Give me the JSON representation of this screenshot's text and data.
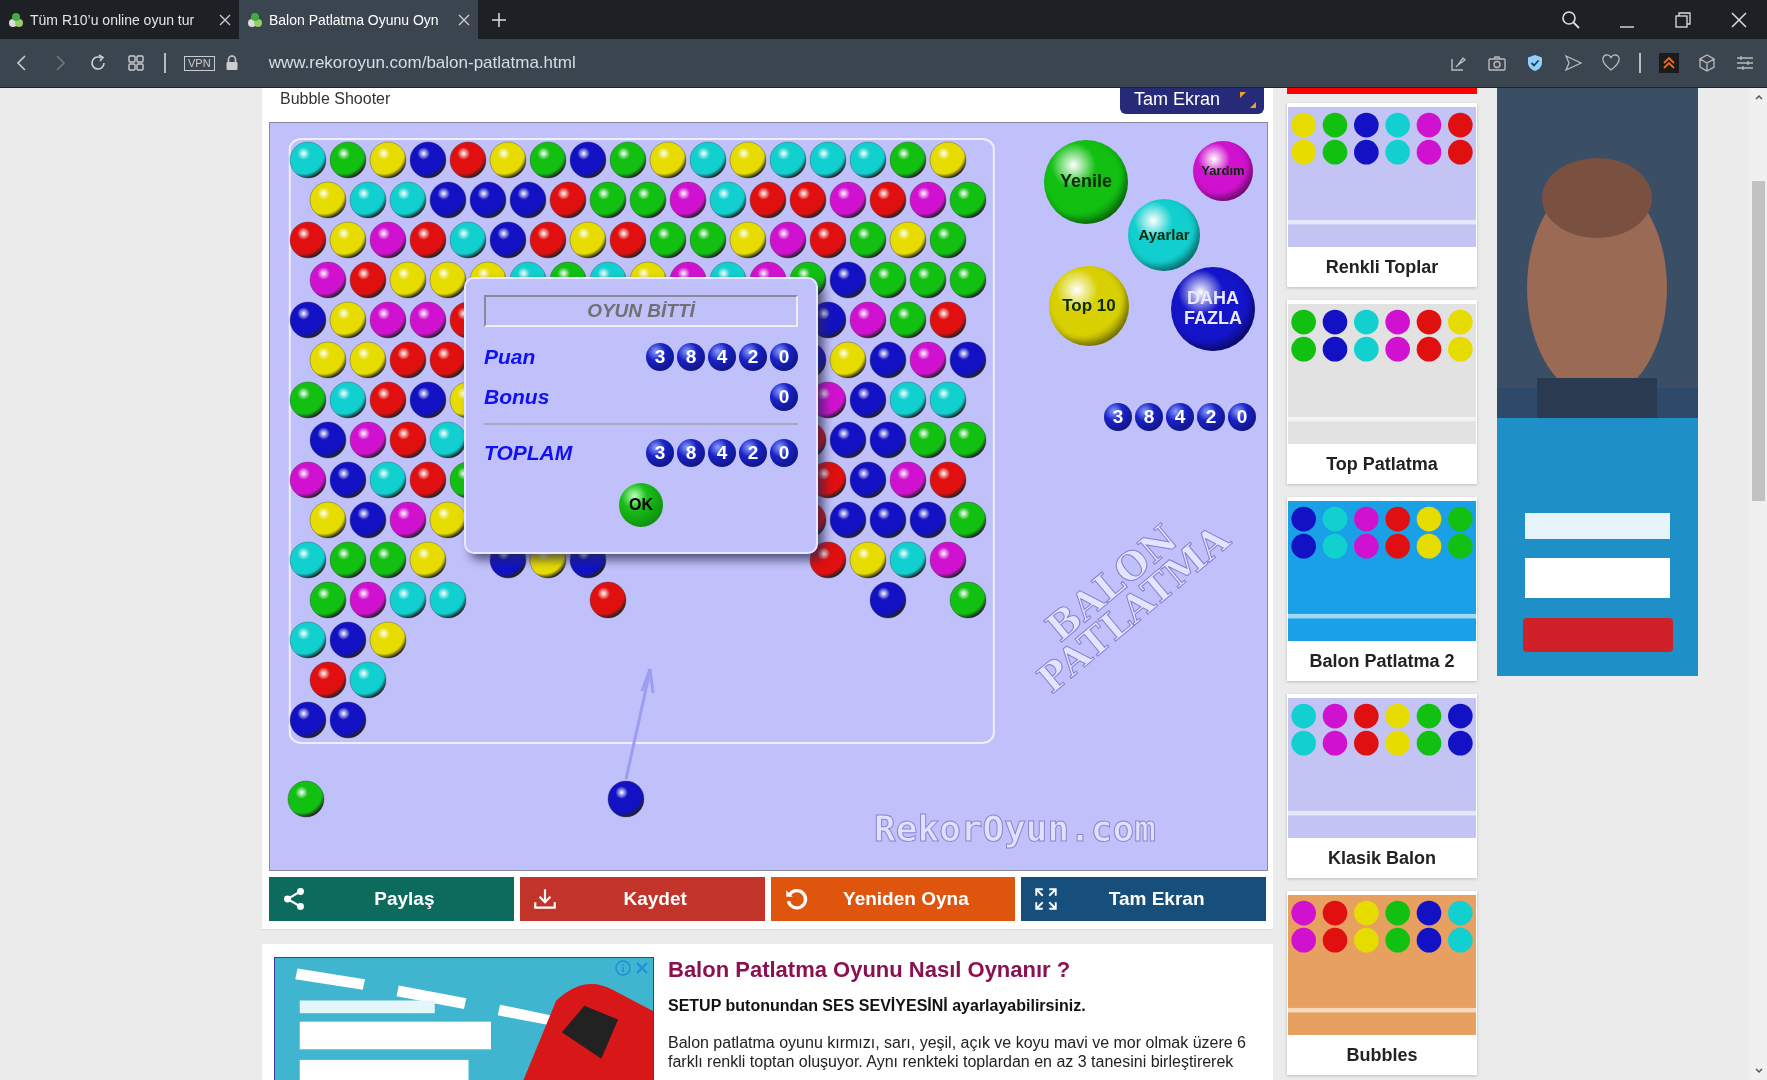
{
  "browser": {
    "tabs": [
      {
        "title": "Tüm R10’u online oyun tur",
        "selected": false
      },
      {
        "title": "Balon Patlatma Oyunu Oyn",
        "selected": true
      }
    ],
    "vpn_label": "VPN",
    "url": "www.rekoroyun.com/balon-patlatma.html"
  },
  "game_title": "Bubble Shooter",
  "top_button": "Tam Ekran",
  "game": {
    "menu_balls": [
      {
        "label": "Yenile",
        "color": "#12c012"
      },
      {
        "label": "Yardım",
        "color": "#d012d0"
      },
      {
        "label": "Ayarlar",
        "color": "#12cfcf"
      },
      {
        "label": "Top 10",
        "color": "#d8d000"
      },
      {
        "label": "DAHA FAZLA",
        "color": "#1414c8"
      }
    ],
    "score_digits": [
      "3",
      "8",
      "4",
      "2",
      "0"
    ],
    "watermark_lines": [
      "BALON",
      "PATLATMA"
    ],
    "site_watermark": "RekorOyun.com",
    "dialog": {
      "title": "OYUN BİTTİ",
      "rows": [
        {
          "label": "Puan",
          "kind": "score",
          "digits": [
            "3",
            "8",
            "4",
            "2",
            "0"
          ]
        },
        {
          "label": "Bonus",
          "kind": "score",
          "digits": [
            "0"
          ]
        },
        {
          "label": "TOPLAM",
          "kind": "total",
          "digits": [
            "3",
            "8",
            "4",
            "2",
            "0"
          ]
        }
      ],
      "ok": "OK"
    }
  },
  "actions": [
    {
      "label": "Paylaş",
      "kind": "share",
      "color": "#0d6b5e"
    },
    {
      "label": "Kaydet",
      "kind": "download",
      "color": "#c2342a"
    },
    {
      "label": "Yeniden Oyna",
      "kind": "replay",
      "color": "#e0550e"
    },
    {
      "label": "Tam Ekran",
      "kind": "fullscreen",
      "color": "#164f7c"
    }
  ],
  "article": {
    "heading": "Balon Patlatma Oyunu Nasıl Oynanır ?",
    "note": "SETUP butonundan SES SEVİYESİNİ ayarlayabilirsiniz.",
    "paragraph": "Balon patlatma oyunu kırmızı, sarı, yeşil, açık ve koyu mavi ve mor olmak üzere 6 farklı renkli toptan oluşuyor. Aynı renkteki toplardan en az 3 tanesini birleştirerek"
  },
  "related": [
    {
      "title": "Renkli Toplar"
    },
    {
      "title": "Top Patlatma"
    },
    {
      "title": "Balon Patlatma 2"
    },
    {
      "title": "Klasik Balon"
    },
    {
      "title": "Bubbles"
    }
  ]
}
